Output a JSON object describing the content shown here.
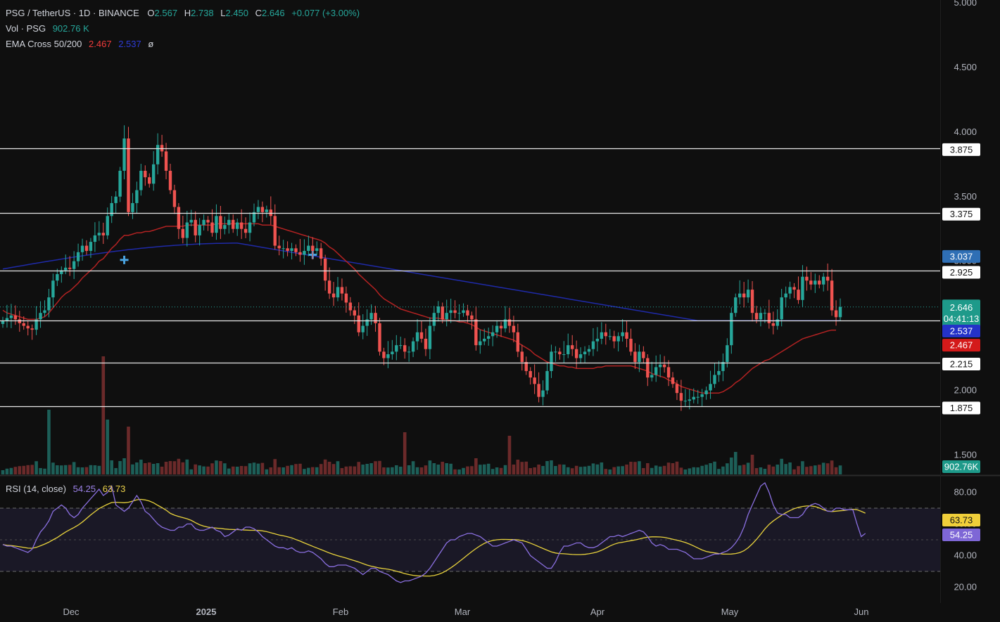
{
  "header": {
    "symbol": "PSG / TetherUS · 1D · BINANCE",
    "o_label": "O",
    "o": "2.567",
    "h_label": "H",
    "h": "2.738",
    "l_label": "L",
    "l": "2.450",
    "c_label": "C",
    "c": "2.646",
    "change": "+0.077 (+3.00%)",
    "vol_label": "Vol · PSG",
    "vol_value": "902.76 K",
    "ema_label": "EMA Cross 50/200",
    "ema50": "2.467",
    "ema200": "2.537",
    "ema_eye": "ø",
    "rsi_label": "RSI (14, close)",
    "rsi_value": "54.25",
    "rsi_ma": "63.73"
  },
  "colors": {
    "up": "#26a69a",
    "down": "#ef5350",
    "ema50": "#b22222",
    "ema200": "#1f2aa8",
    "rsi": "#8a6fe0",
    "rsi_ma": "#e8d23c",
    "background": "#0f0f0f"
  },
  "chart_data": {
    "type": "candlestick",
    "symbol": "PSG/USDT",
    "interval": "1D",
    "price_axis": {
      "ticks": [
        "5.000",
        "4.500",
        "4.000",
        "3.500",
        "3.000",
        "2.500",
        "2.000",
        "1.500"
      ],
      "range": [
        1.35,
        5.0
      ]
    },
    "x_axis": {
      "labels": [
        "Dec",
        "2025",
        "Feb",
        "Mar",
        "Apr",
        "May",
        "Jun"
      ]
    },
    "horizontal_levels": [
      "3.875",
      "3.375",
      "2.925",
      "2.540",
      "2.215",
      "1.875"
    ],
    "price_tags": [
      {
        "label": "3.037",
        "kind": "ema200-prev"
      },
      {
        "label": "2.646",
        "sub": "04:41:13",
        "kind": "last"
      },
      {
        "label": "2.537",
        "kind": "ema200"
      },
      {
        "label": "2.467",
        "kind": "ema50"
      }
    ],
    "volume_tag": "902.76K",
    "rsi_axis": {
      "ticks": [
        "80.00",
        "60.00",
        "40.00",
        "20.00"
      ],
      "bands": [
        30,
        70
      ],
      "mid": 50
    },
    "rsi_tags": {
      "ma": "63.73",
      "rsi": "54.25"
    },
    "close_series": [
      2.54,
      2.56,
      2.58,
      2.55,
      2.52,
      2.5,
      2.48,
      2.47,
      2.55,
      2.6,
      2.62,
      2.72,
      2.85,
      2.9,
      2.93,
      2.95,
      2.94,
      3.0,
      3.07,
      3.12,
      3.08,
      3.15,
      3.2,
      3.22,
      3.2,
      3.35,
      3.45,
      3.5,
      3.7,
      3.95,
      3.38,
      3.45,
      3.55,
      3.7,
      3.65,
      3.6,
      3.75,
      3.9,
      3.85,
      3.7,
      3.55,
      3.42,
      3.25,
      3.18,
      3.3,
      3.32,
      3.2,
      3.28,
      3.32,
      3.3,
      3.22,
      3.35,
      3.25,
      3.28,
      3.32,
      3.25,
      3.3,
      3.25,
      3.22,
      3.3,
      3.38,
      3.42,
      3.38,
      3.4,
      3.35,
      3.12,
      3.1,
      3.1,
      3.08,
      3.1,
      3.07,
      3.05,
      3.08,
      3.12,
      3.08,
      3.1,
      3.02,
      2.85,
      2.75,
      2.72,
      2.8,
      2.75,
      2.68,
      2.62,
      2.58,
      2.45,
      2.5,
      2.55,
      2.6,
      2.52,
      2.3,
      2.25,
      2.28,
      2.3,
      2.35,
      2.35,
      2.3,
      2.3,
      2.38,
      2.45,
      2.4,
      2.32,
      2.5,
      2.6,
      2.65,
      2.55,
      2.6,
      2.62,
      2.6,
      2.6,
      2.62,
      2.58,
      2.55,
      2.35,
      2.38,
      2.4,
      2.42,
      2.45,
      2.5,
      2.48,
      2.55,
      2.5,
      2.45,
      2.3,
      2.22,
      2.15,
      2.1,
      2.05,
      1.95,
      2.0,
      2.15,
      2.3,
      2.3,
      2.28,
      2.28,
      2.35,
      2.32,
      2.25,
      2.28,
      2.3,
      2.32,
      2.38,
      2.4,
      2.45,
      2.42,
      2.42,
      2.38,
      2.42,
      2.45,
      2.4,
      2.3,
      2.22,
      2.3,
      2.25,
      2.1,
      2.12,
      2.18,
      2.2,
      2.18,
      2.1,
      2.05,
      1.98,
      1.92,
      1.92,
      1.93,
      1.95,
      1.95,
      1.97,
      2.0,
      2.05,
      2.12,
      2.15,
      2.22,
      2.35,
      2.6,
      2.72,
      2.75,
      2.72,
      2.78,
      2.6,
      2.55,
      2.6,
      2.6,
      2.52,
      2.5,
      2.55,
      2.72,
      2.75,
      2.8,
      2.78,
      2.7,
      2.88,
      2.85,
      2.82,
      2.85,
      2.82,
      2.88,
      2.85,
      2.62,
      2.567,
      2.646
    ],
    "ema50_series": [
      2.62,
      2.6,
      2.59,
      2.58,
      2.57,
      2.56,
      2.55,
      2.55,
      2.55,
      2.56,
      2.57,
      2.6,
      2.64,
      2.68,
      2.72,
      2.75,
      2.77,
      2.8,
      2.83,
      2.87,
      2.9,
      2.93,
      2.96,
      3.0,
      3.02,
      3.06,
      3.1,
      3.13,
      3.17,
      3.2,
      3.2,
      3.21,
      3.22,
      3.22,
      3.23,
      3.23,
      3.24,
      3.25,
      3.26,
      3.27,
      3.27,
      3.27,
      3.27,
      3.27,
      3.28,
      3.28,
      3.28,
      3.28,
      3.28,
      3.28,
      3.28,
      3.29,
      3.29,
      3.29,
      3.29,
      3.29,
      3.29,
      3.29,
      3.29,
      3.29,
      3.29,
      3.29,
      3.28,
      3.28,
      3.28,
      3.27,
      3.26,
      3.25,
      3.24,
      3.23,
      3.22,
      3.21,
      3.2,
      3.19,
      3.18,
      3.17,
      3.16,
      3.14,
      3.11,
      3.09,
      3.06,
      3.03,
      3.0,
      2.97,
      2.94,
      2.9,
      2.87,
      2.84,
      2.81,
      2.78,
      2.74,
      2.71,
      2.69,
      2.67,
      2.65,
      2.63,
      2.62,
      2.61,
      2.6,
      2.59,
      2.58,
      2.57,
      2.56,
      2.56,
      2.56,
      2.55,
      2.55,
      2.54,
      2.54,
      2.53,
      2.53,
      2.52,
      2.51,
      2.49,
      2.47,
      2.46,
      2.45,
      2.44,
      2.43,
      2.42,
      2.41,
      2.4,
      2.39,
      2.37,
      2.35,
      2.33,
      2.31,
      2.28,
      2.26,
      2.24,
      2.22,
      2.21,
      2.2,
      2.19,
      2.19,
      2.18,
      2.18,
      2.17,
      2.17,
      2.17,
      2.17,
      2.17,
      2.18,
      2.18,
      2.19,
      2.19,
      2.19,
      2.19,
      2.19,
      2.19,
      2.19,
      2.18,
      2.17,
      2.16,
      2.15,
      2.13,
      2.12,
      2.11,
      2.1,
      2.08,
      2.07,
      2.05,
      2.03,
      2.02,
      2.01,
      2.0,
      1.99,
      1.98,
      1.98,
      1.98,
      1.98,
      1.98,
      1.99,
      2.01,
      2.03,
      2.06,
      2.08,
      2.11,
      2.14,
      2.17,
      2.19,
      2.21,
      2.23,
      2.24,
      2.26,
      2.28,
      2.3,
      2.32,
      2.34,
      2.36,
      2.38,
      2.4,
      2.41,
      2.42,
      2.43,
      2.44,
      2.45,
      2.46,
      2.467,
      2.467
    ],
    "rsi_series": [
      47,
      46,
      46,
      45,
      44,
      43,
      42,
      44,
      50,
      55,
      58,
      62,
      68,
      70,
      72,
      70,
      66,
      64,
      66,
      70,
      73,
      76,
      79,
      82,
      78,
      80,
      84,
      72,
      70,
      68,
      70,
      74,
      78,
      74,
      68,
      66,
      63,
      60,
      58,
      57,
      56,
      56,
      58,
      58,
      60,
      60,
      57,
      56,
      56,
      57,
      58,
      56,
      55,
      52,
      53,
      55,
      57,
      56,
      58,
      58,
      57,
      55,
      52,
      50,
      48,
      46,
      45,
      45,
      44,
      45,
      43,
      42,
      42,
      43,
      42,
      40,
      38,
      35,
      33,
      33,
      34,
      34,
      34,
      33,
      32,
      30,
      28,
      30,
      32,
      32,
      30,
      29,
      28,
      26,
      24,
      23,
      24,
      24,
      25,
      26,
      27,
      29,
      32,
      36,
      40,
      44,
      48,
      50,
      50,
      52,
      53,
      54,
      54,
      53,
      52,
      50,
      48,
      46,
      46,
      47,
      48,
      49,
      50,
      49,
      48,
      44,
      40,
      38,
      36,
      34,
      32,
      32,
      36,
      42,
      46,
      46,
      47,
      48,
      48,
      46,
      45,
      45,
      46,
      48,
      50,
      52,
      52,
      53,
      52,
      53,
      54,
      55,
      56,
      55,
      52,
      48,
      46,
      47,
      46,
      44,
      44,
      44,
      43,
      42,
      40,
      38,
      38,
      38,
      39,
      40,
      41,
      41,
      42,
      43,
      45,
      48,
      52,
      58,
      66,
      72,
      78,
      84,
      86,
      80,
      72,
      67,
      66,
      66,
      64,
      64,
      64,
      66,
      70,
      72,
      73,
      72,
      70,
      68,
      68,
      70,
      70,
      69,
      69,
      69,
      60,
      52,
      54
    ]
  }
}
